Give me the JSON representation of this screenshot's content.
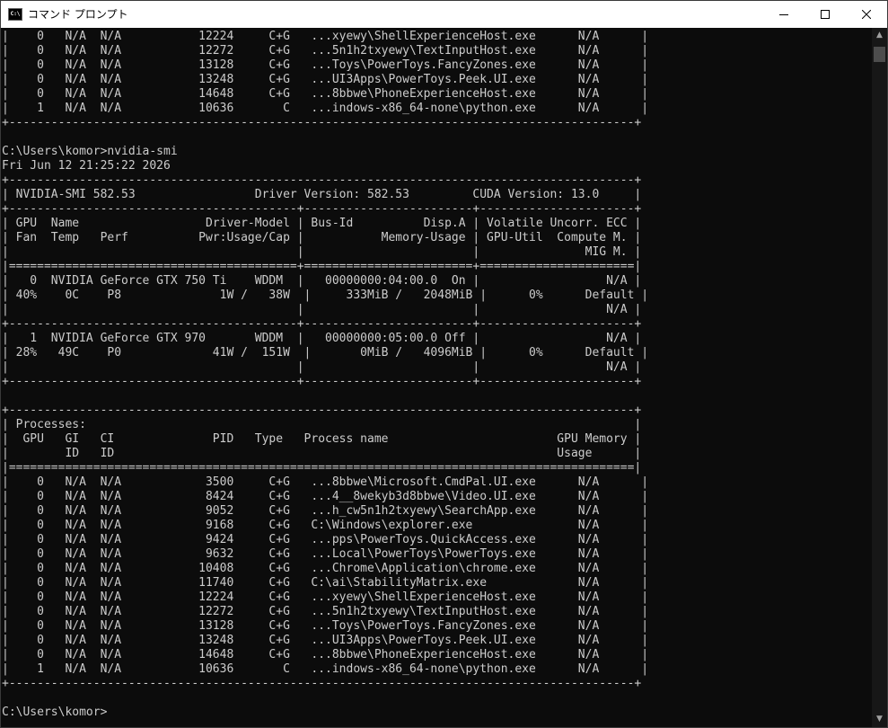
{
  "window": {
    "title": "コマンド プロンプト",
    "icon_label": "C:\\",
    "controls": [
      "minimize-icon",
      "maximize-icon",
      "close-icon"
    ]
  },
  "scrollbar": {
    "up_arrow": "▲",
    "down_arrow": "▼"
  },
  "console_lines": [
    "|    0   N/A  N/A           12224     C+G   ...xyewy\\ShellExperienceHost.exe      N/A      |",
    "|    0   N/A  N/A           12272     C+G   ...5n1h2txyewy\\TextInputHost.exe      N/A      |",
    "|    0   N/A  N/A           13128     C+G   ...Toys\\PowerToys.FancyZones.exe      N/A      |",
    "|    0   N/A  N/A           13248     C+G   ...UI3Apps\\PowerToys.Peek.UI.exe      N/A      |",
    "|    0   N/A  N/A           14648     C+G   ...8bbwe\\PhoneExperienceHost.exe      N/A      |",
    "|    1   N/A  N/A           10636       C   ...indows-x86_64-none\\python.exe      N/A      |",
    "+-----------------------------------------------------------------------------------------+",
    "",
    "C:\\Users\\komor>nvidia-smi",
    "Fri Jun 12 21:25:22 2026",
    "+-----------------------------------------------------------------------------------------+",
    "| NVIDIA-SMI 582.53                 Driver Version: 582.53         CUDA Version: 13.0     |",
    "+-----------------------------------------+------------------------+----------------------+",
    "| GPU  Name                  Driver-Model | Bus-Id          Disp.A | Volatile Uncorr. ECC |",
    "| Fan  Temp   Perf          Pwr:Usage/Cap |           Memory-Usage | GPU-Util  Compute M. |",
    "|                                         |                        |               MIG M. |",
    "|=========================================+========================+======================|",
    "|   0  NVIDIA GeForce GTX 750 Ti    WDDM  |   00000000:04:00.0  On |                  N/A |",
    "| 40%    0C    P8              1W /   38W  |     333MiB /   2048MiB |      0%      Default |",
    "|                                         |                        |                  N/A |",
    "+-----------------------------------------+------------------------+----------------------+",
    "|   1  NVIDIA GeForce GTX 970       WDDM  |   00000000:05:00.0 Off |                  N/A |",
    "| 28%   49C    P0             41W /  151W  |       0MiB /   4096MiB |      0%      Default |",
    "|                                         |                        |                  N/A |",
    "+-----------------------------------------+------------------------+----------------------+",
    "",
    "+-----------------------------------------------------------------------------------------+",
    "| Processes:                                                                              |",
    "|  GPU   GI   CI              PID   Type   Process name                        GPU Memory |",
    "|        ID   ID                                                               Usage      |",
    "|=========================================================================================|",
    "|    0   N/A  N/A            3500     C+G   ...8bbwe\\Microsoft.CmdPal.UI.exe      N/A      |",
    "|    0   N/A  N/A            8424     C+G   ...4__8wekyb3d8bbwe\\Video.UI.exe      N/A      |",
    "|    0   N/A  N/A            9052     C+G   ...h_cw5n1h2txyewy\\SearchApp.exe      N/A      |",
    "|    0   N/A  N/A            9168     C+G   C:\\Windows\\explorer.exe               N/A      |",
    "|    0   N/A  N/A            9424     C+G   ...pps\\PowerToys.QuickAccess.exe      N/A      |",
    "|    0   N/A  N/A            9632     C+G   ...Local\\PowerToys\\PowerToys.exe      N/A      |",
    "|    0   N/A  N/A           10408     C+G   ...Chrome\\Application\\chrome.exe      N/A      |",
    "|    0   N/A  N/A           11740     C+G   C:\\ai\\StabilityMatrix.exe             N/A      |",
    "|    0   N/A  N/A           12224     C+G   ...xyewy\\ShellExperienceHost.exe      N/A      |",
    "|    0   N/A  N/A           12272     C+G   ...5n1h2txyewy\\TextInputHost.exe      N/A      |",
    "|    0   N/A  N/A           13128     C+G   ...Toys\\PowerToys.FancyZones.exe      N/A      |",
    "|    0   N/A  N/A           13248     C+G   ...UI3Apps\\PowerToys.Peek.UI.exe      N/A      |",
    "|    0   N/A  N/A           14648     C+G   ...8bbwe\\PhoneExperienceHost.exe      N/A      |",
    "|    1   N/A  N/A           10636       C   ...indows-x86_64-none\\python.exe      N/A      |",
    "+-----------------------------------------------------------------------------------------+",
    "",
    "C:\\Users\\komor>"
  ]
}
